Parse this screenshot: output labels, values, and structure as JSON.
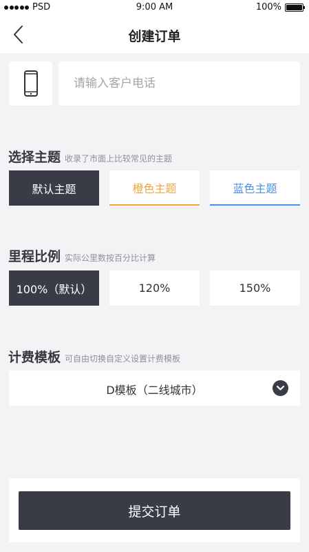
{
  "status_bar": {
    "carrier": "PSD",
    "time": "9:00 AM",
    "battery": "100%"
  },
  "nav": {
    "title": "创建订单"
  },
  "phone": {
    "placeholder": "请输入客户电话",
    "value": ""
  },
  "theme": {
    "title": "选择主题",
    "subtitle": "收录了市面上比较常见的主题",
    "options": [
      "默认主题",
      "橙色主题",
      "蓝色主题"
    ],
    "selected_index": 0
  },
  "mileage": {
    "title": "里程比例",
    "subtitle": "实际公里数按百分比计算",
    "options": [
      "100%（默认）",
      "120%",
      "150%"
    ],
    "selected_index": 0
  },
  "template": {
    "title": "计费模板",
    "subtitle": "可自由切换自定义设置计费模板",
    "selected": "D模板（二线城市）"
  },
  "submit_label": "提交订单",
  "colors": {
    "dark": "#393b47",
    "orange": "#f0a640",
    "blue": "#4a90e2",
    "background": "#f3f3f6"
  },
  "icons": [
    "signal-dots-icon",
    "battery-icon",
    "back-chevron-icon",
    "phone-icon",
    "chevron-down-icon"
  ]
}
